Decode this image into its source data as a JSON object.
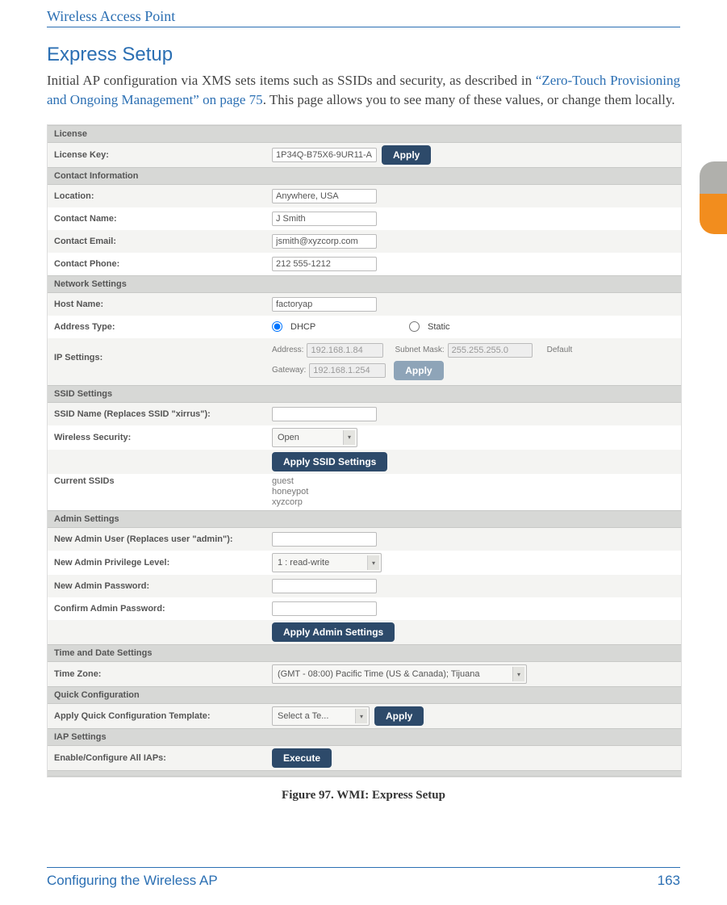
{
  "header": {
    "running": "Wireless Access Point"
  },
  "title": "Express Setup",
  "para": {
    "t1": "Initial AP configuration via XMS sets items such as SSIDs and security, as described in ",
    "link": "“Zero-Touch Provisioning and Ongoing Management” on page 75",
    "t2": ". This page allows you to see many of these values, or change them locally."
  },
  "ui": {
    "license": {
      "head": "License",
      "key_label": "License Key:",
      "key_value": "1P34Q-B75X6-9UR11-A",
      "apply": "Apply"
    },
    "contact": {
      "head": "Contact Information",
      "location_label": "Location:",
      "location": "Anywhere, USA",
      "name_label": "Contact Name:",
      "name": "J Smith",
      "email_label": "Contact Email:",
      "email": "jsmith@xyzcorp.com",
      "phone_label": "Contact Phone:",
      "phone": "212 555-1212"
    },
    "network": {
      "head": "Network Settings",
      "host_label": "Host Name:",
      "host": "factoryap",
      "addr_type_label": "Address Type:",
      "dhcp": "DHCP",
      "static": "Static",
      "ip_label": "IP Settings:",
      "addr_label": "Address:",
      "addr": "192.168.1.84",
      "mask_label": "Subnet Mask:",
      "mask": "255.255.255.0",
      "default": "Default",
      "gw_label": "Gateway:",
      "gw": "192.168.1.254",
      "apply": "Apply"
    },
    "ssid": {
      "head": "SSID Settings",
      "name_label": "SSID Name (Replaces SSID \"xirrus\"):",
      "sec_label": "Wireless Security:",
      "sec_value": "Open",
      "apply": "Apply SSID Settings",
      "current_label": "Current SSIDs",
      "list": [
        "guest",
        "honeypot",
        "xyzcorp"
      ]
    },
    "admin": {
      "head": "Admin Settings",
      "user_label": "New Admin User (Replaces user \"admin\"):",
      "priv_label": "New Admin Privilege Level:",
      "priv_value": "1 : read-write",
      "pw_label": "New Admin Password:",
      "cpw_label": "Confirm Admin Password:",
      "apply": "Apply Admin Settings"
    },
    "time": {
      "head": "Time and Date Settings",
      "tz_label": "Time Zone:",
      "tz_value": "(GMT - 08:00) Pacific Time (US & Canada); Tijuana"
    },
    "quick": {
      "head": "Quick Configuration",
      "tpl_label": "Apply Quick Configuration Template:",
      "tpl_value": "Select a Te...",
      "apply": "Apply"
    },
    "iap": {
      "head": "IAP Settings",
      "label": "Enable/Configure All IAPs:",
      "exec": "Execute"
    }
  },
  "caption": "Figure 97. WMI: Express Setup",
  "footer": {
    "left": "Configuring the Wireless AP",
    "right": "163"
  }
}
